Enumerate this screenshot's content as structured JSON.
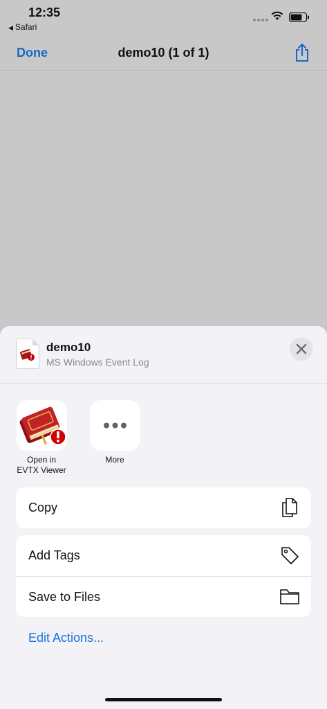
{
  "status_bar": {
    "time": "12:35",
    "back_app": "Safari",
    "icons": [
      "signal-icon",
      "wifi-icon",
      "battery-icon"
    ]
  },
  "nav": {
    "done_label": "Done",
    "title": "demo10 (1 of 1)",
    "share_icon": "share-icon"
  },
  "sheet": {
    "file_name": "demo10",
    "file_kind": "MS Windows Event Log",
    "close_icon": "close-icon",
    "apps": [
      {
        "label_line1": "Open in",
        "label_line2": "EVTX Viewer",
        "icon": "evtx-viewer-app-icon"
      },
      {
        "label_line1": "More",
        "label_line2": "",
        "icon": "more-icon"
      }
    ],
    "actions_group1": [
      {
        "label": "Copy",
        "icon": "copy-icon"
      }
    ],
    "actions_group2": [
      {
        "label": "Add Tags",
        "icon": "tag-icon"
      },
      {
        "label": "Save to Files",
        "icon": "folder-icon"
      }
    ],
    "edit_actions_label": "Edit Actions..."
  },
  "colors": {
    "accent": "#1a73d9",
    "sheet_bg": "#f2f2f7",
    "backdrop": "#c8c8c8"
  }
}
